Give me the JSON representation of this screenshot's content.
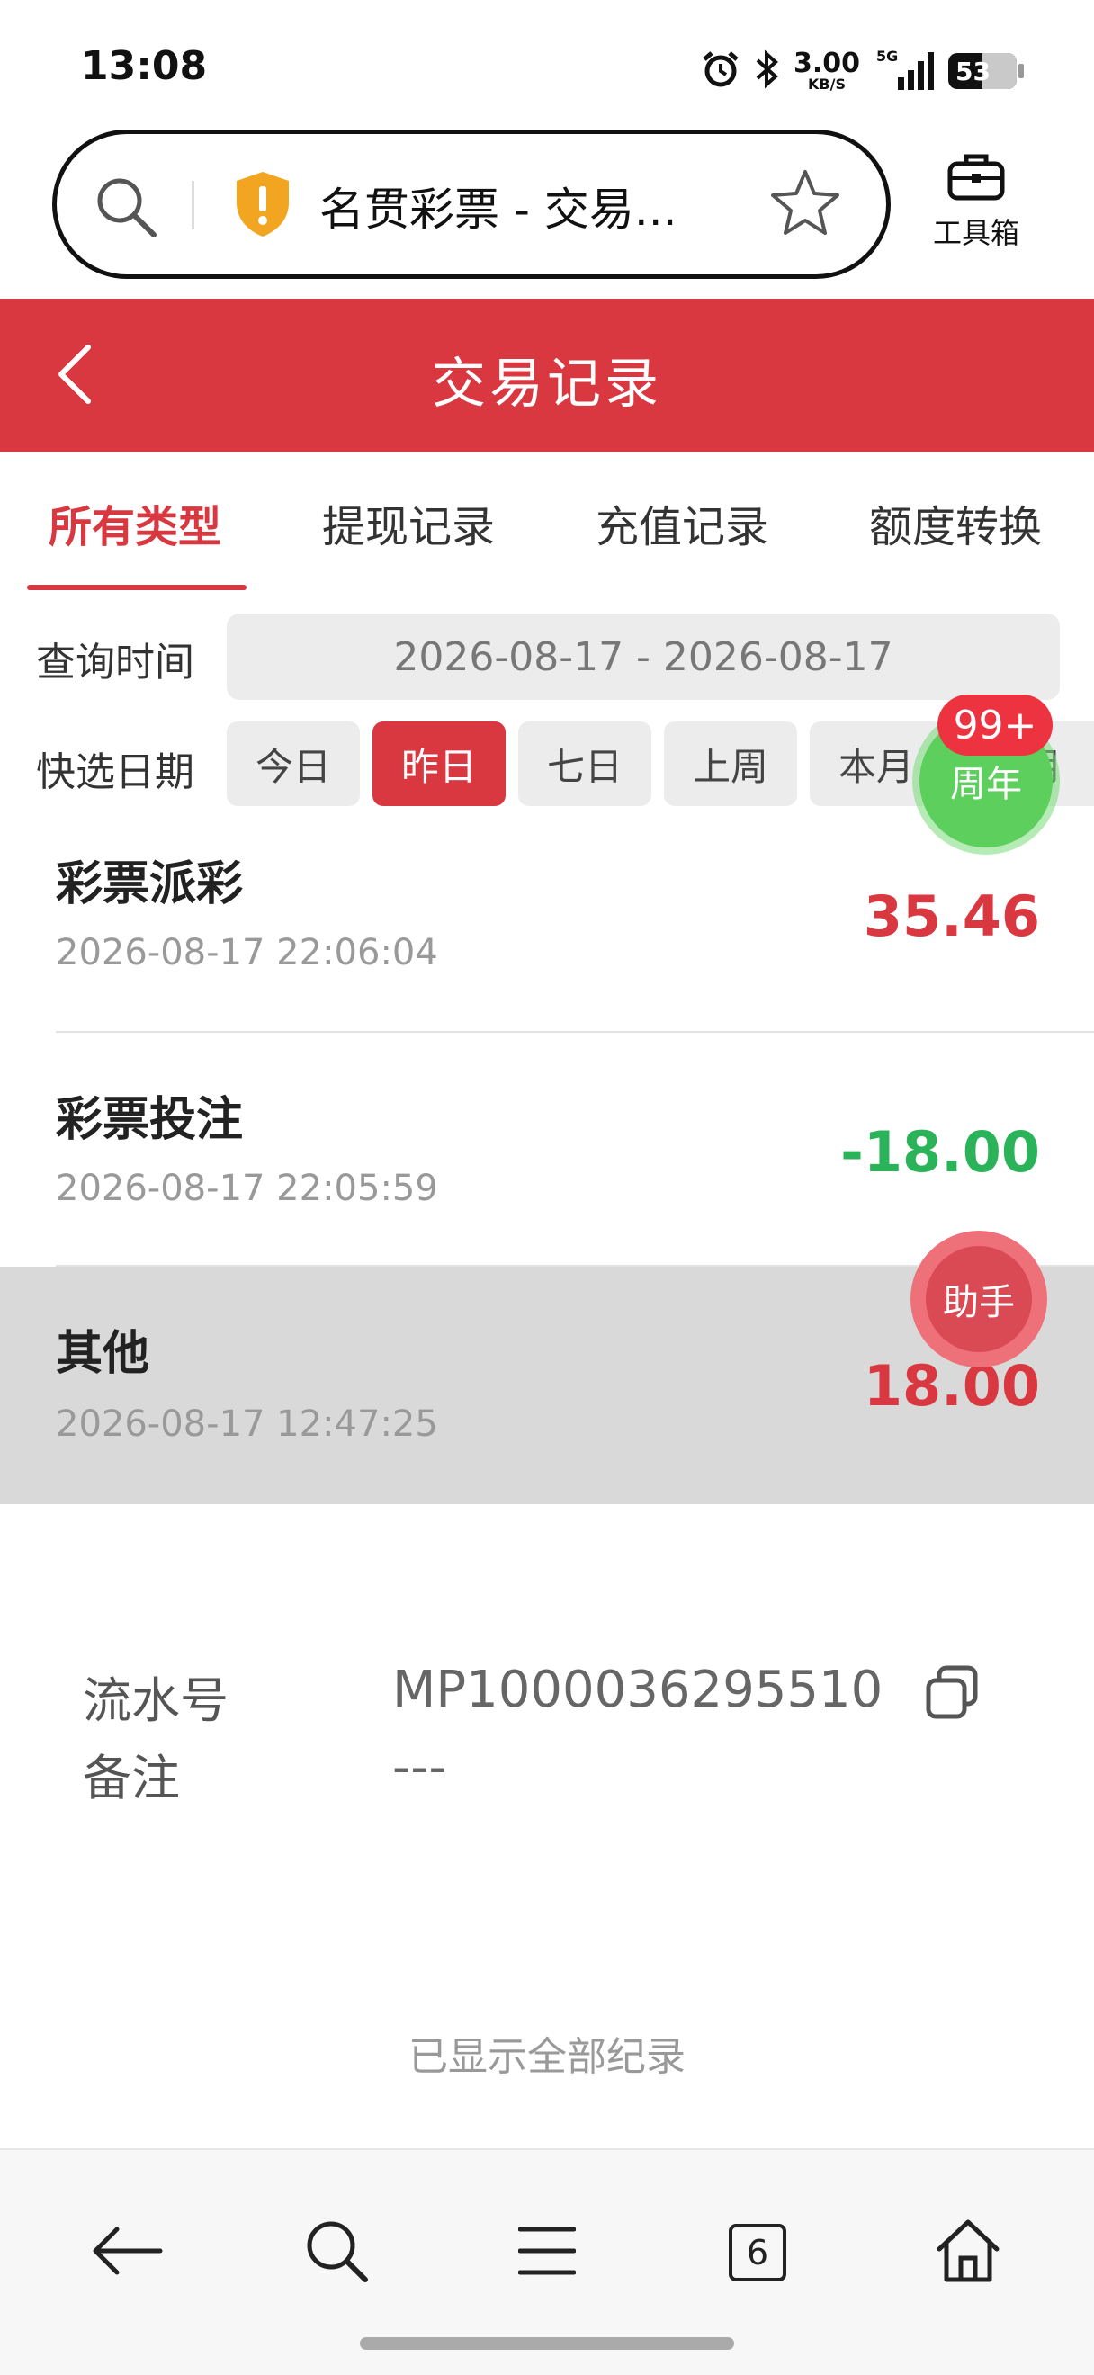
{
  "status_bar": {
    "time": "13:08",
    "net_speed_value": "3.00",
    "net_speed_unit": "KB/S",
    "network": "5G",
    "battery": "53"
  },
  "address_bar": {
    "title": "名贯彩票 - 交易...",
    "toolbox_label": "工具箱"
  },
  "header": {
    "title": "交易记录"
  },
  "tabs": [
    {
      "label": "所有类型",
      "active": true
    },
    {
      "label": "提现记录",
      "active": false
    },
    {
      "label": "充值记录",
      "active": false
    },
    {
      "label": "额度转换",
      "active": false
    }
  ],
  "query": {
    "label": "查询时间",
    "range": "2026-08-17 - 2026-08-17"
  },
  "quick_dates": {
    "label": "快选日期",
    "options": [
      "今日",
      "昨日",
      "七日",
      "上周",
      "本月",
      "上月"
    ],
    "selected": "昨日"
  },
  "anniversary": {
    "label": "周年",
    "badge": "99+"
  },
  "transactions": [
    {
      "title": "彩票派彩",
      "time": "2026-08-17 22:06:04",
      "amount": "35.46",
      "sign": "positive"
    },
    {
      "title": "彩票投注",
      "time": "2026-08-17 22:05:59",
      "amount": "-18.00",
      "sign": "negative"
    },
    {
      "title": "其他",
      "time": "2026-08-17 12:47:25",
      "amount": "18.00",
      "sign": "positive",
      "highlighted": true
    }
  ],
  "helper": {
    "label": "助手"
  },
  "detail": {
    "serial_label": "流水号",
    "serial_value": "MP1000036295510",
    "note_label": "备注",
    "note_value": "---"
  },
  "footer_text": "已显示全部纪录",
  "bottom_nav": {
    "tabs_count": "6"
  },
  "colors": {
    "brand_red": "#d93841",
    "positive_amount": "#d93841",
    "negative_amount": "#2bb35a",
    "anniversary_green": "#5ccf5c"
  },
  "icons": [
    "search-icon",
    "shield-warning-icon",
    "star-icon",
    "toolbox-icon",
    "back-arrow-icon",
    "copy-icon",
    "nav-back-icon",
    "nav-search-icon",
    "nav-menu-icon",
    "nav-tabs-icon",
    "nav-home-icon",
    "alarm-icon",
    "bluetooth-icon",
    "signal-icon",
    "battery-icon"
  ]
}
